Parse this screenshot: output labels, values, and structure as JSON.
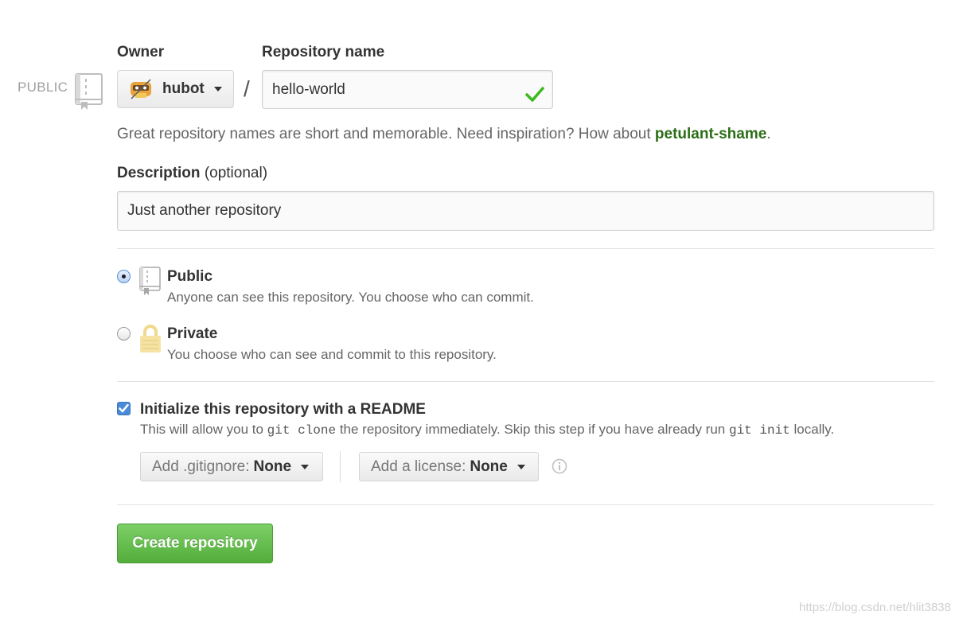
{
  "visibility_indicator": "PUBLIC",
  "owner": {
    "label": "Owner",
    "value": "hubot"
  },
  "separator": "/",
  "repo_name": {
    "label": "Repository name",
    "value": "hello-world"
  },
  "name_hint": {
    "text": "Great repository names are short and memorable. Need inspiration? How about ",
    "suggestion": "petulant-shame",
    "suffix": "."
  },
  "description": {
    "label": "Description",
    "optional": "(optional)",
    "value": "Just another repository"
  },
  "visibility_options": [
    {
      "title": "Public",
      "description": "Anyone can see this repository. You choose who can commit.",
      "selected": true
    },
    {
      "title": "Private",
      "description": "You choose who can see and commit to this repository.",
      "selected": false
    }
  ],
  "init_readme": {
    "title": "Initialize this repository with a README",
    "help_prefix": "This will allow you to ",
    "code1": "git clone",
    "help_middle": " the repository immediately. Skip this step if you have already run ",
    "code2": "git init",
    "help_suffix": " locally.",
    "checked": true
  },
  "gitignore": {
    "label": "Add .gitignore:",
    "value": "None"
  },
  "license": {
    "label": "Add a license:",
    "value": "None"
  },
  "submit": {
    "label": "Create repository"
  },
  "watermark": "https://blog.csdn.net/hlit3838",
  "colors": {
    "accent_green": "#5cb846",
    "suggestion_green": "#2b6e16",
    "valid_check": "#3cb820"
  }
}
